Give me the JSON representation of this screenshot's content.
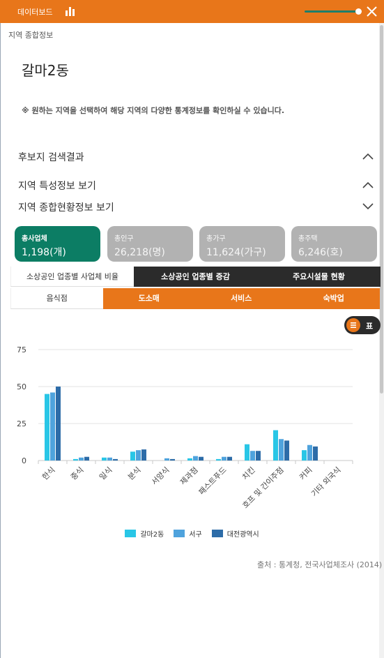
{
  "topbar": {
    "title": "데이터보드",
    "slider_value": 0.92,
    "accent": "#e8761a",
    "icons": [
      "bar-chart-icon",
      "close-icon"
    ]
  },
  "breadcrumb": "지역 종합정보",
  "page_title": "갈마2동",
  "notice": "※ 원하는 지역을 선택하여 해당 지역의 다양한 통계정보를 확인하실 수 있습니다.",
  "sections": [
    {
      "label": "후보지 검색결과",
      "state": "expanded"
    },
    {
      "label": "지역 특성정보 보기",
      "state": "expanded"
    },
    {
      "label": "지역 종합현황정보 보기",
      "state": "collapsed"
    }
  ],
  "stats": [
    {
      "label": "총사업체",
      "value": "1,198(개)",
      "active": true
    },
    {
      "label": "총인구",
      "value": "26,218(명)",
      "active": false
    },
    {
      "label": "총가구",
      "value": "11,624(가구)",
      "active": false
    },
    {
      "label": "총주택",
      "value": "6,246(호)",
      "active": false
    }
  ],
  "tabs_primary": [
    "소상공인 업종별 사업체 비율",
    "소상공인 업종별 증감",
    "주요시설물 현황"
  ],
  "tabs_secondary": [
    "음식점",
    "도소매",
    "서비스",
    "숙박업"
  ],
  "table_toggle_label": "표",
  "colors": {
    "series1": "#29c6e6",
    "series2": "#4fa3dd",
    "series3": "#2d6ca8",
    "card_active": "#0c7d64",
    "card_inactive": "#b2b2b2",
    "dark_tab": "#2b2b2b"
  },
  "chart_data": {
    "type": "bar",
    "categories": [
      "한식",
      "중식",
      "일식",
      "분식",
      "서양식",
      "제과점",
      "패스트푸드",
      "치킨",
      "호프 및 간이주점",
      "커피",
      "기타 외국식"
    ],
    "series": [
      {
        "name": "갈마2동",
        "values": [
          45,
          1,
          2,
          6,
          0,
          1.5,
          1,
          11,
          20.5,
          7,
          0
        ]
      },
      {
        "name": "서구",
        "values": [
          46,
          2,
          2,
          7,
          1.5,
          3,
          2.5,
          6.5,
          14.5,
          10.5,
          0
        ]
      },
      {
        "name": "대전광역시",
        "values": [
          50,
          2.5,
          1,
          7.5,
          1,
          2.5,
          2.5,
          6.5,
          13.5,
          9.5,
          0
        ]
      }
    ],
    "yticks": [
      0,
      25,
      50,
      75
    ],
    "ylim": [
      0,
      75
    ],
    "grid": true,
    "legend_position": "bottom"
  },
  "source": "출처 : 통계청, 전국사업체조사 (2014)"
}
